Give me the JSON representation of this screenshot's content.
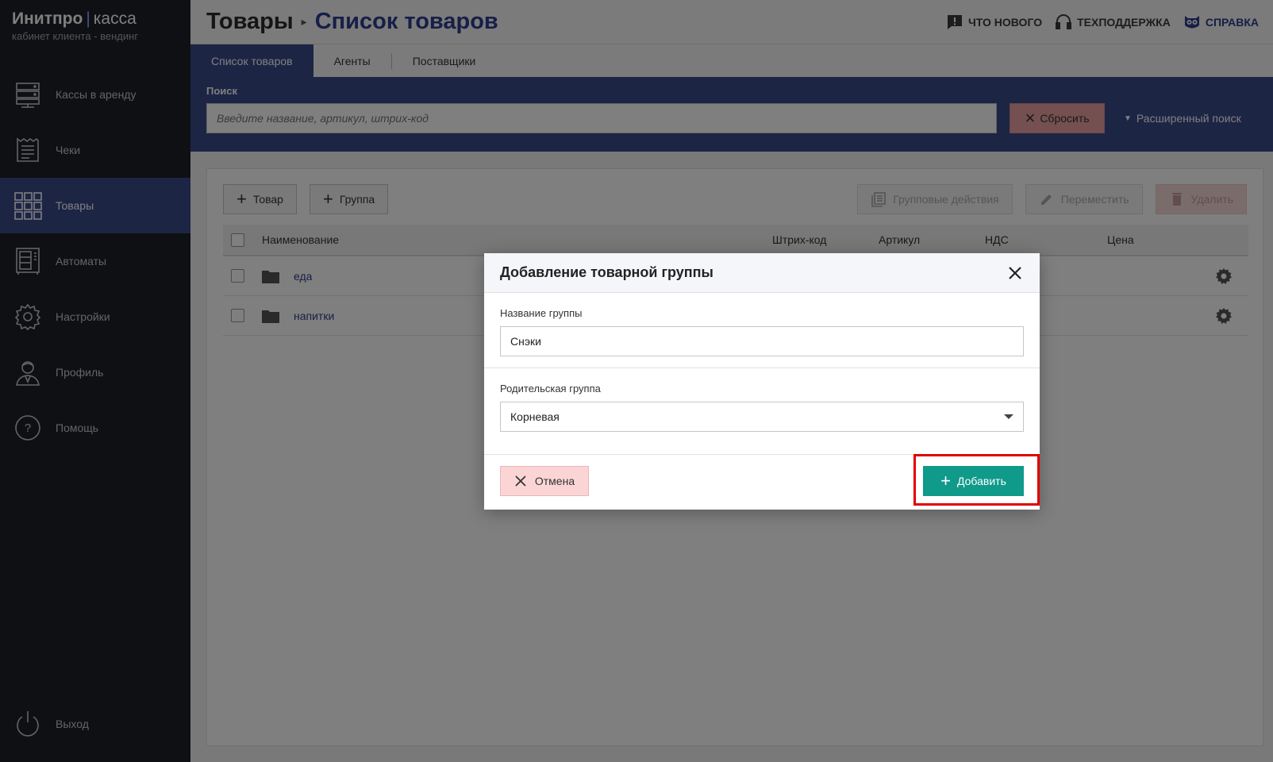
{
  "brand": {
    "name": "Инитпро",
    "separator": "|",
    "product": "касса",
    "caption": "кабинет клиента - вендинг"
  },
  "sidebar": {
    "items": [
      {
        "label": "Кассы в аренду",
        "icon": "server-icon",
        "active": false
      },
      {
        "label": "Чеки",
        "icon": "receipt-icon",
        "active": false
      },
      {
        "label": "Товары",
        "icon": "grid-icon",
        "active": true
      },
      {
        "label": "Автоматы",
        "icon": "vending-machine-icon",
        "active": false
      },
      {
        "label": "Настройки",
        "icon": "gear-icon",
        "active": false
      },
      {
        "label": "Профиль",
        "icon": "user-icon",
        "active": false
      },
      {
        "label": "Помощь",
        "icon": "help-icon",
        "active": false
      }
    ],
    "logout": {
      "label": "Выход",
      "icon": "power-icon"
    }
  },
  "header": {
    "root": "Товары",
    "current": "Список товаров",
    "links": {
      "news": "что нового",
      "support": "техподдержка",
      "help": "справка"
    }
  },
  "tabs": [
    "Список товаров",
    "Агенты",
    "Поставщики"
  ],
  "search": {
    "title": "Поиск",
    "placeholder": "Введите название, артикул, штрих-код",
    "reset_label": "Сбросить",
    "advanced_label": "Расширенный поиск"
  },
  "toolbar": {
    "add_product": "Товар",
    "add_group": "Группа",
    "group_actions": "Групповые действия",
    "move": "Переместить",
    "delete": "Удалить"
  },
  "table": {
    "columns": {
      "name": "Наименование",
      "barcode": "Штрих-код",
      "article": "Артикул",
      "vat": "НДС",
      "price": "Цена"
    },
    "rows": [
      {
        "name": "еда"
      },
      {
        "name": "напитки"
      }
    ]
  },
  "modal": {
    "title": "Добавление товарной группы",
    "name_label": "Название группы",
    "name_value": "Снэки",
    "parent_label": "Родительская группа",
    "parent_value": "Корневая",
    "cancel_label": "Отмена",
    "add_label": "Добавить"
  },
  "colors": {
    "sidebar_bg": "#1f2026",
    "accent": "#3b4a8a",
    "title_blue": "#2f3d8f",
    "add_button": "#0f9a8a",
    "highlight": "#e00000"
  }
}
